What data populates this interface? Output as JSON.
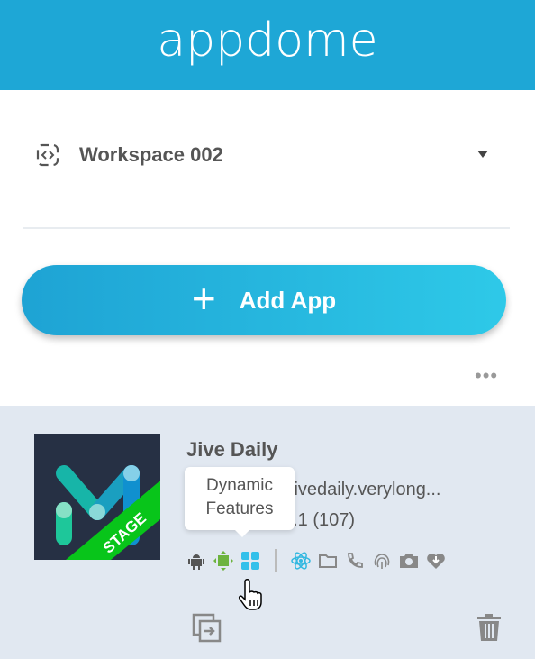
{
  "header": {
    "logo": "appdome",
    "color": "#1ea7d6"
  },
  "workspace": {
    "name": "Workspace 002",
    "icon": "code-brackets-icon"
  },
  "add_app": {
    "label": "Add App",
    "icon": "plus-icon"
  },
  "more_menu": "•••",
  "app": {
    "name": "Jive Daily",
    "package": "jivedaily.verylong...",
    "version": "3.1 (107)",
    "badge": "STAGE",
    "icons": [
      "android-icon",
      "appdome-engine-icon",
      "dynamic-features-icon",
      "react-native-icon",
      "folder-icon",
      "phone-icon",
      "fingerprint-icon",
      "camera-icon",
      "heart-download-icon"
    ],
    "tooltip": "Dynamic Features",
    "tooltip_lines": [
      "Dynamic",
      "Features"
    ]
  },
  "actions": {
    "copy": "copy-icon",
    "delete": "trash-icon"
  }
}
